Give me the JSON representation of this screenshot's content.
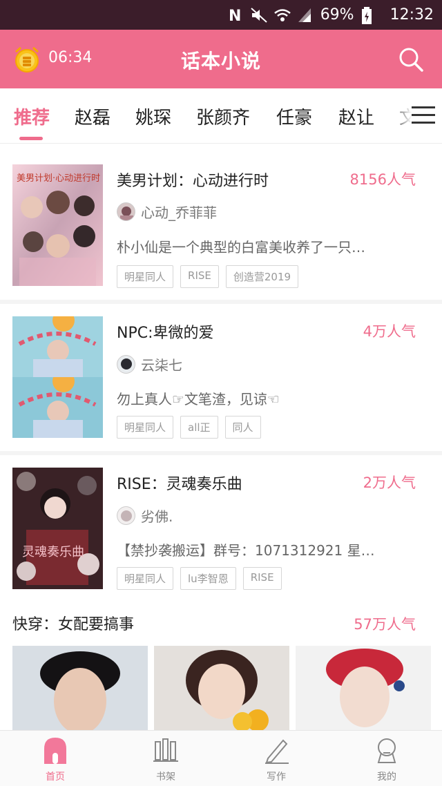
{
  "status_bar": {
    "battery": "69%",
    "time": "12:32"
  },
  "app_bar": {
    "alarm_time": "06:34",
    "title": "话本小说"
  },
  "tabs": [
    {
      "label": "推荐"
    },
    {
      "label": "赵磊"
    },
    {
      "label": "姚琛"
    },
    {
      "label": "张颜齐"
    },
    {
      "label": "任豪"
    },
    {
      "label": "赵让"
    },
    {
      "label": "文"
    }
  ],
  "stories": [
    {
      "title": "美男计划：心动进行时",
      "popularity": "8156人气",
      "author": "心动_乔菲菲",
      "description": "朴小仙是一个典型的白富美收养了一只…",
      "tags": [
        "明星同人",
        "RISE",
        "创造营2019"
      ],
      "cover_text": "美男计划·心动进行时"
    },
    {
      "title": "NPC:卑微的爱",
      "popularity": "4万人气",
      "author": "云柒七",
      "description": "勿上真人☞文笔渣，见谅☜",
      "tags": [
        "明星同人",
        "all正",
        "同人"
      ]
    },
    {
      "title": "RISE：灵魂奏乐曲",
      "popularity": "2万人气",
      "author": "劣佛.",
      "description": "【禁抄袭搬运】群号：1071312921 星…",
      "tags": [
        "明星同人",
        "lu李智恩",
        "RISE"
      ],
      "cover_text": "灵魂奏乐曲"
    }
  ],
  "feature": {
    "title": "快穿：女配要搞事",
    "popularity": "57万人气"
  },
  "bottom_nav": [
    {
      "label": "首页"
    },
    {
      "label": "书架"
    },
    {
      "label": "写作"
    },
    {
      "label": "我的"
    }
  ],
  "colors": {
    "accent": "#ef6c8c",
    "status_bar": "#3b1d2a"
  }
}
